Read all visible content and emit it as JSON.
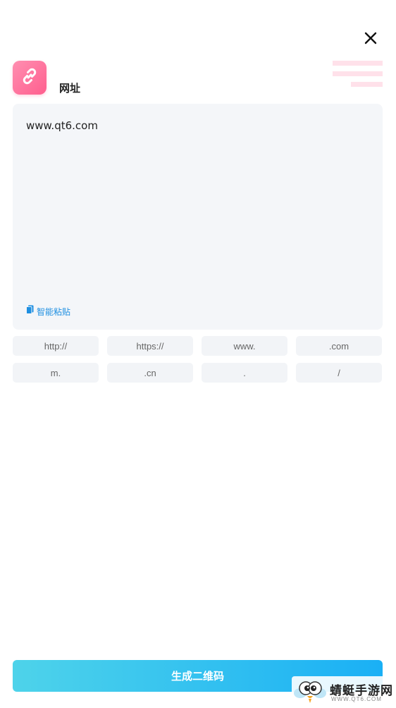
{
  "header": {
    "title": "网址",
    "app_icon": "link-icon",
    "close_icon": "close-icon",
    "accent_color": "#ff5e8e"
  },
  "input": {
    "value": "www.qt6.com",
    "smart_paste_label": "智能粘贴",
    "smart_paste_icon": "clipboard-icon",
    "smart_paste_color": "#1e8fe1"
  },
  "quick_chips": [
    "http://",
    "https://",
    "www.",
    ".com",
    "m.",
    ".cn",
    ".",
    "/"
  ],
  "generate_button": {
    "label": "生成二维码",
    "color_start": "#4ed3ea",
    "color_end": "#1ab0f5"
  },
  "watermark": {
    "name": "蜻蜓手游网",
    "url": "WWW.QT6.COM"
  }
}
